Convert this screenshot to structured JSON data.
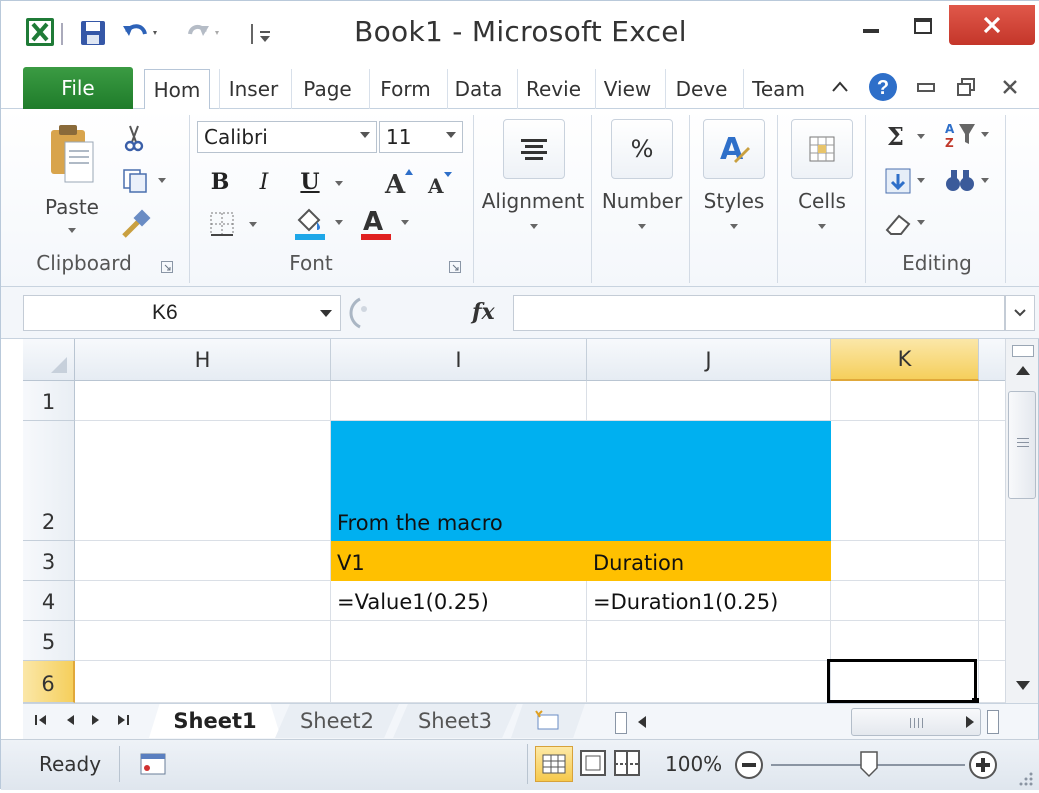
{
  "window": {
    "title": "Book1  -  Microsoft Excel"
  },
  "tabs": [
    {
      "id": "file",
      "label": "File"
    },
    {
      "id": "home",
      "label": "Hom"
    },
    {
      "id": "insert",
      "label": "Inser"
    },
    {
      "id": "page",
      "label": "Page"
    },
    {
      "id": "formulas",
      "label": "Form"
    },
    {
      "id": "data",
      "label": "Data"
    },
    {
      "id": "review",
      "label": "Revie"
    },
    {
      "id": "view",
      "label": "View"
    },
    {
      "id": "developer",
      "label": "Deve"
    },
    {
      "id": "team",
      "label": "Team"
    }
  ],
  "ribbon": {
    "clipboard": {
      "paste": "Paste",
      "label": "Clipboard"
    },
    "font": {
      "name": "Calibri",
      "size": "11",
      "label": "Font",
      "bold": "B",
      "italic": "I",
      "underline": "U"
    },
    "alignment": {
      "label": "Alignment"
    },
    "number": {
      "label": "Number"
    },
    "styles": {
      "label": "Styles"
    },
    "cells": {
      "label": "Cells"
    },
    "editing": {
      "label": "Editing"
    }
  },
  "formula_bar": {
    "name_box": "K6",
    "fx": "fx",
    "formula": ""
  },
  "grid": {
    "columns": [
      "H",
      "I",
      "J",
      "K"
    ],
    "selected_column": "K",
    "rows": [
      "1",
      "2",
      "3",
      "4",
      "5",
      "6"
    ],
    "selected_row": "6",
    "cells": {
      "I2": "From the macro",
      "I3": "V1",
      "J3": "Duration",
      "I4": "=Value1(0.25)",
      "J4": "=Duration1(0.25)"
    },
    "fill_colors": {
      "blue": "#00b0f0",
      "orange": "#ffc000"
    }
  },
  "sheets": [
    {
      "label": "Sheet1",
      "active": true
    },
    {
      "label": "Sheet2",
      "active": false
    },
    {
      "label": "Sheet3",
      "active": false
    }
  ],
  "status": {
    "ready": "Ready",
    "zoom": "100%"
  }
}
